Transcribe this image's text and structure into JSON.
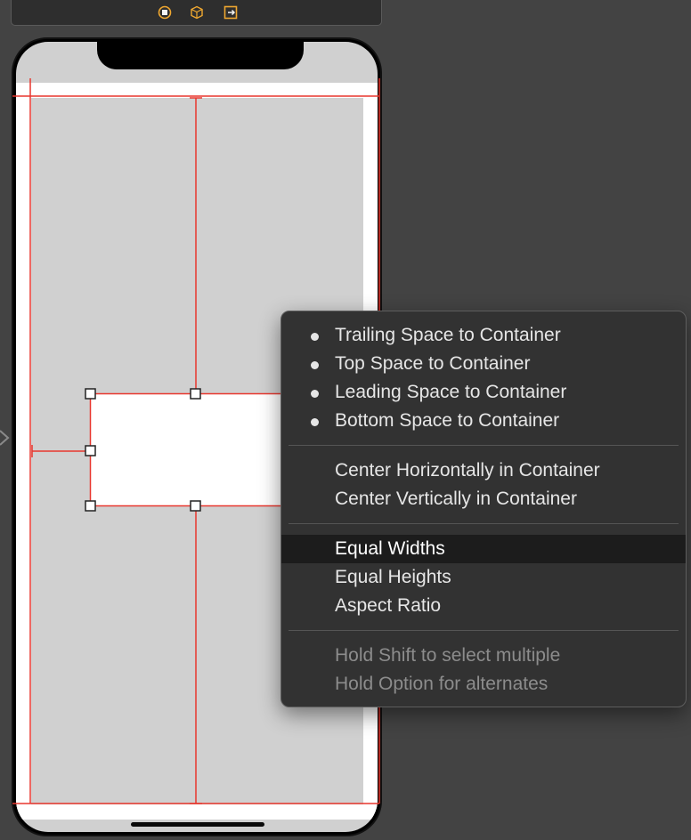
{
  "scene_bar": {
    "icons": [
      "view-controller-icon",
      "first-responder-icon",
      "exit-icon"
    ]
  },
  "canvas": {
    "device": "iphone-with-notch",
    "constraint_color": "#e8372e"
  },
  "context_menu": {
    "groups": [
      [
        {
          "label": "Trailing Space to Container",
          "bullet": true
        },
        {
          "label": "Top Space to Container",
          "bullet": true
        },
        {
          "label": "Leading Space to Container",
          "bullet": true
        },
        {
          "label": "Bottom Space to Container",
          "bullet": true
        }
      ],
      [
        {
          "label": "Center Horizontally in Container"
        },
        {
          "label": "Center Vertically in Container"
        }
      ],
      [
        {
          "label": "Equal Widths",
          "selected": true
        },
        {
          "label": "Equal Heights"
        },
        {
          "label": "Aspect Ratio"
        }
      ],
      [
        {
          "label": "Hold Shift to select multiple",
          "disabled": true
        },
        {
          "label": "Hold Option for alternates",
          "disabled": true
        }
      ]
    ]
  }
}
